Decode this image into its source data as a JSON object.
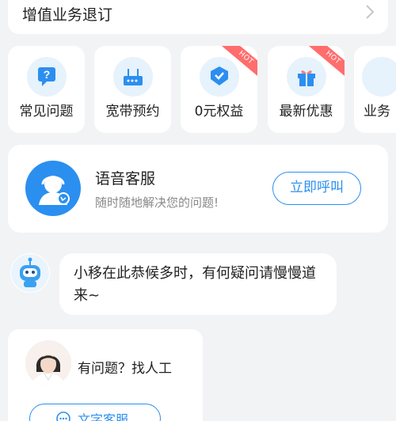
{
  "value_added": {
    "label": "增值业务退订"
  },
  "tiles": [
    {
      "label": "常见问题",
      "icon": "faq-icon",
      "hot": ""
    },
    {
      "label": "宽带预约",
      "icon": "router-icon",
      "hot": ""
    },
    {
      "label": "0元权益",
      "icon": "badge-icon",
      "hot": "HOT"
    },
    {
      "label": "最新优惠",
      "icon": "gift-icon",
      "hot": "HOT"
    },
    {
      "label": "业务",
      "icon": "business-icon",
      "hot": ""
    }
  ],
  "voice_service": {
    "title": "语音客服",
    "subtitle": "随时随地解决您的问题!",
    "call_label": "立即呼叫"
  },
  "bot_message": {
    "text": "小移在此恭候多时，有何疑问请慢慢道来~"
  },
  "human_service": {
    "text": "有问题？找人工",
    "button_label": "文字客服"
  },
  "colors": {
    "accent": "#2b8ff0",
    "hot": "#ff6d6d",
    "background": "#f2f3f5"
  }
}
